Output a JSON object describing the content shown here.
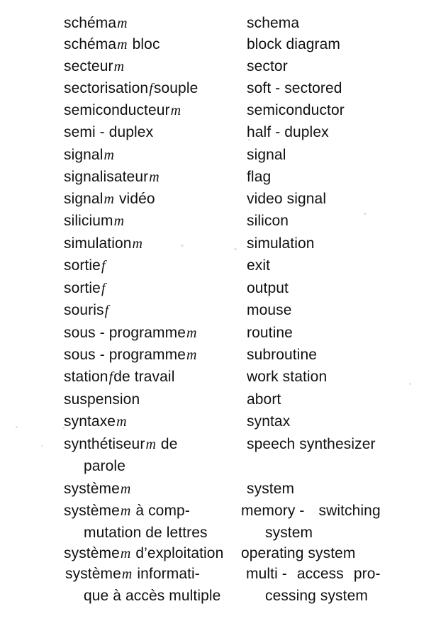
{
  "page": {
    "kind": "scanned-dictionary-page",
    "language_pair": "French – English",
    "background_color": "#ffffff",
    "text_color": "#111111"
  },
  "entries": [
    {
      "fr_text": "schéma",
      "fr_gender": "m",
      "fr_tail": "",
      "en": "schema"
    },
    {
      "fr_text": "schéma",
      "fr_gender": "m",
      "fr_tail": " bloc",
      "en": "block diagram"
    },
    {
      "fr_text": "secteur",
      "fr_gender": "m",
      "fr_tail": "",
      "en": "sector"
    },
    {
      "fr_text": "sectorisation",
      "fr_gender": "f",
      "fr_tail": "souple",
      "en": "soft - sectored"
    },
    {
      "fr_text": "semiconducteur",
      "fr_gender": "m",
      "fr_tail": "",
      "en": "semiconductor"
    },
    {
      "fr_text": "semi - duplex",
      "fr_gender": "",
      "fr_tail": "",
      "en": "half - duplex"
    },
    {
      "fr_text": "signal",
      "fr_gender": "m",
      "fr_tail": "",
      "en": "signal"
    },
    {
      "fr_text": "signalisateur",
      "fr_gender": "m",
      "fr_tail": "",
      "en": "flag"
    },
    {
      "fr_text": "signal",
      "fr_gender": "m",
      "fr_tail": " vidéo",
      "en": "video signal"
    },
    {
      "fr_text": "silicium",
      "fr_gender": "m",
      "fr_tail": "",
      "en": "silicon"
    },
    {
      "fr_text": "simulation",
      "fr_gender": "m",
      "fr_tail": "",
      "en": "simulation"
    },
    {
      "fr_text": "sortie",
      "fr_gender": "f",
      "fr_tail": "",
      "en": "exit"
    },
    {
      "fr_text": "sortie",
      "fr_gender": "f",
      "fr_tail": "",
      "en": "output"
    },
    {
      "fr_text": "souris",
      "fr_gender": "f",
      "fr_tail": "",
      "en": "mouse"
    },
    {
      "fr_text": "sous - programme",
      "fr_gender": "m",
      "fr_tail": "",
      "en": "routine"
    },
    {
      "fr_text": "sous - programme",
      "fr_gender": "m",
      "fr_tail": "",
      "en": "subroutine"
    },
    {
      "fr_text": "station",
      "fr_gender": "f",
      "fr_tail": "de travail",
      "en": "work station"
    },
    {
      "fr_text": "suspension",
      "fr_gender": "",
      "fr_tail": "",
      "en": "abort"
    },
    {
      "fr_text": "syntaxe",
      "fr_gender": "m",
      "fr_tail": "",
      "en": "syntax"
    },
    {
      "fr_text": "synthétiseur",
      "fr_gender": "m",
      "fr_tail": " de",
      "en": "speech synthesizer"
    },
    {
      "fr_text": "parole",
      "fr_gender": "",
      "fr_tail": "",
      "en": "",
      "fr_continuation": true
    },
    {
      "fr_text": "système",
      "fr_gender": "m",
      "fr_tail": "",
      "en": "system"
    },
    {
      "fr_text": "système",
      "fr_gender": "m",
      "fr_tail": " à comp-",
      "en": "memory -"
    },
    {
      "fr_text": "mutation de lettres",
      "fr_gender": "",
      "fr_tail": "",
      "en": "system",
      "fr_continuation": true,
      "en_continuation": true
    },
    {
      "fr_text": "système",
      "fr_gender": "m",
      "fr_tail": " d’exploitation",
      "en": "operating system"
    },
    {
      "fr_text": "système",
      "fr_gender": "m",
      "fr_tail": " informati-",
      "en": "multi -"
    },
    {
      "fr_text": "que à accès multiple",
      "fr_gender": "",
      "fr_tail": "",
      "en": "cessing system",
      "fr_continuation": true,
      "en_continuation": true
    }
  ],
  "justified_fragments": {
    "memory_switching": {
      "before": "memory -",
      "after": "switching"
    },
    "multi_access_pro": {
      "before": "multi -",
      "mid": "access",
      "after": "pro-"
    }
  }
}
